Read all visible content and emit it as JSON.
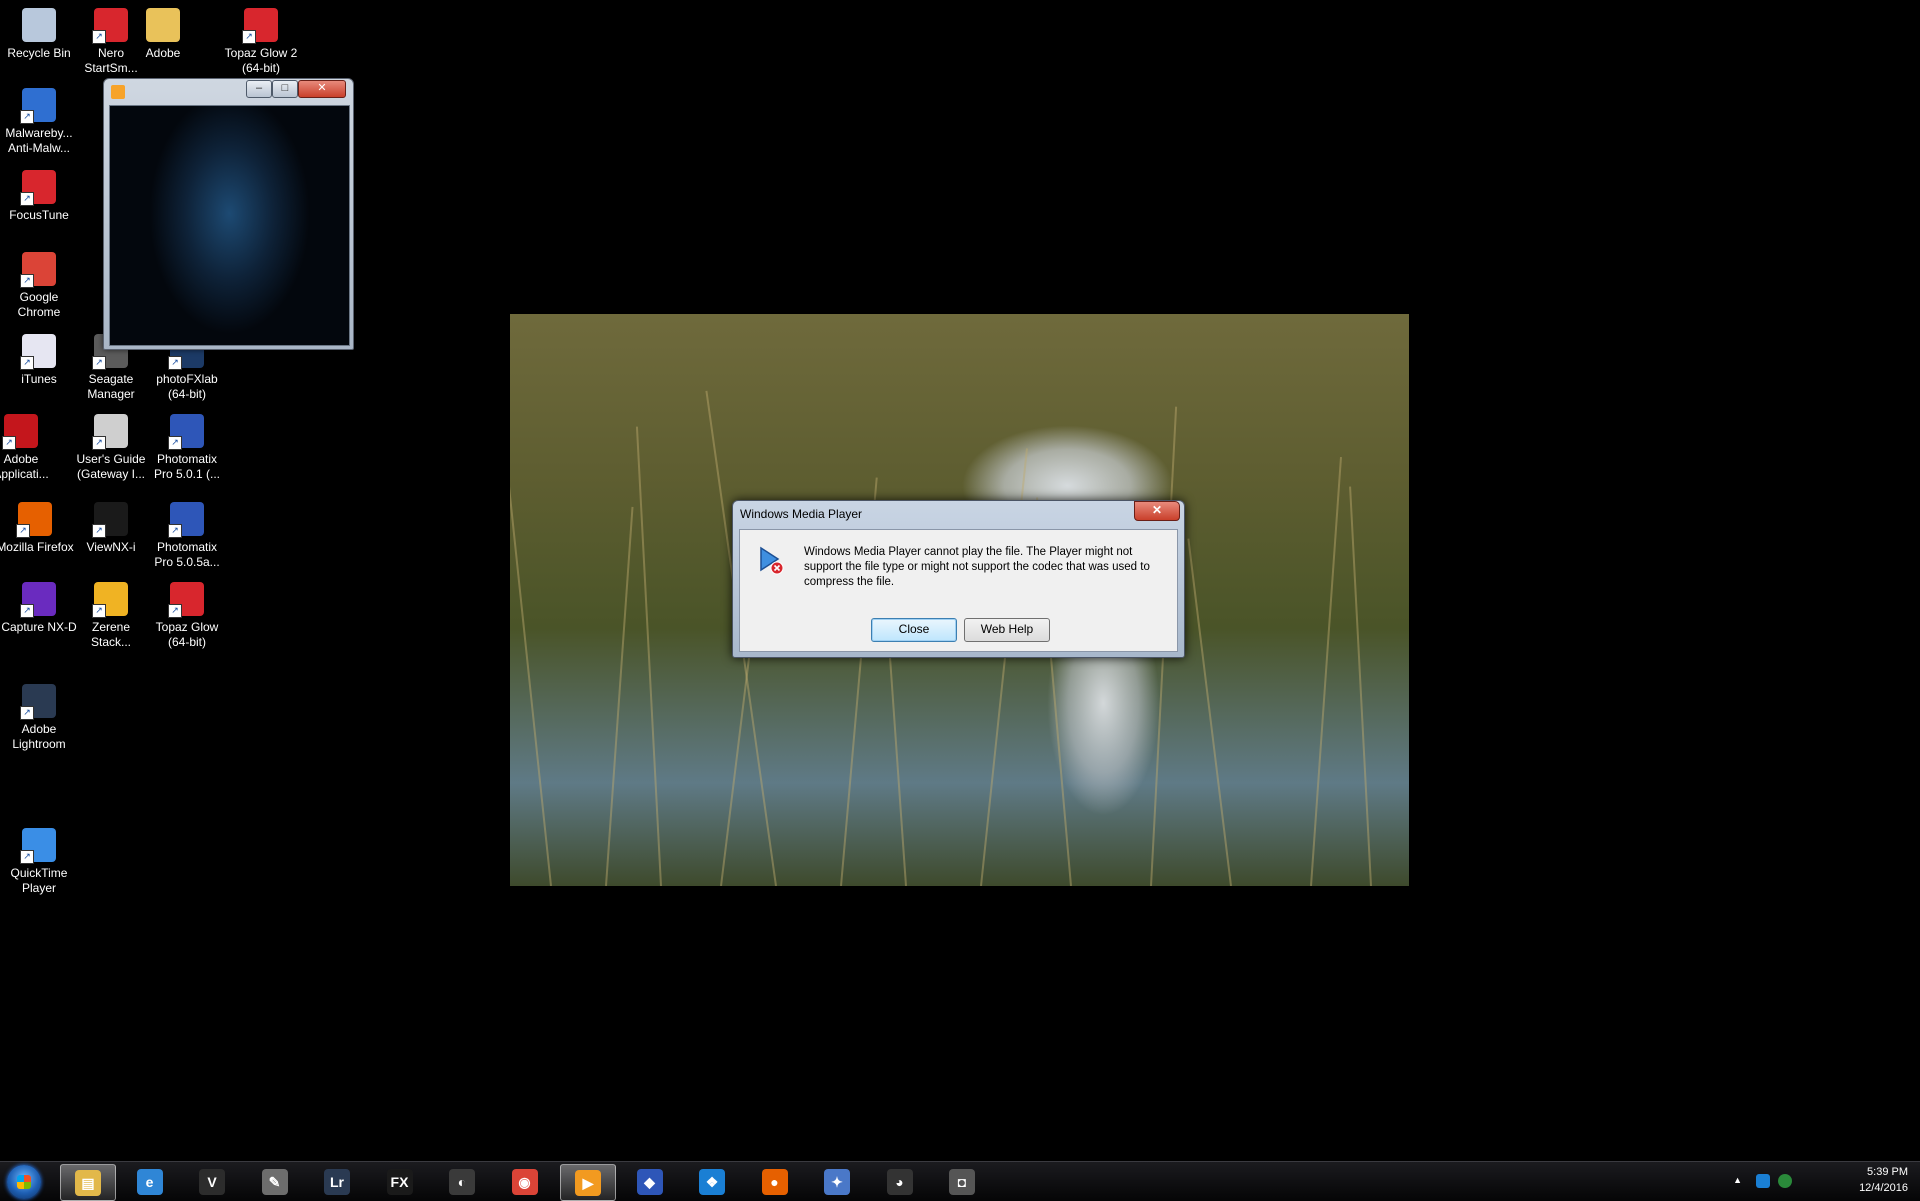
{
  "desktop": {
    "icons": [
      {
        "label": "Recycle Bin",
        "icon": "recycle-bin-icon",
        "color": "#b8c8dc"
      },
      {
        "label": "Nero StartSm...",
        "icon": "nero-icon",
        "color": "#d8262d"
      },
      {
        "label": "Adobe",
        "icon": "folder-icon",
        "color": "#e9c25a"
      },
      {
        "label": "Topaz Glow 2 (64-bit)",
        "icon": "topaz-glow-icon",
        "color": "#d8262d"
      },
      {
        "label": "Malwareby... Anti-Malw...",
        "icon": "malwarebytes-icon",
        "color": "#2f6fd1"
      },
      {
        "label": "FocusTune",
        "icon": "focustune-icon",
        "color": "#d8262d"
      },
      {
        "label": "Google Chrome",
        "icon": "chrome-icon",
        "color": "#db4437"
      },
      {
        "label": "iTunes",
        "icon": "itunes-icon",
        "color": "#e6e6f2"
      },
      {
        "label": "Seagate Manager",
        "icon": "seagate-icon",
        "color": "#5b5b5b"
      },
      {
        "label": "photoFXlab (64-bit)",
        "icon": "photofxlab-icon",
        "color": "#1c3a66"
      },
      {
        "label": "Adobe Applicati...",
        "icon": "adobe-icon",
        "color": "#c4161c"
      },
      {
        "label": "User's Guide (Gateway I...",
        "icon": "help-icon",
        "color": "#cfcfcf"
      },
      {
        "label": "Photomatix Pro 5.0.1 (...",
        "icon": "photomatix-icon",
        "color": "#2e56b8"
      },
      {
        "label": "Mozilla Firefox",
        "icon": "firefox-icon",
        "color": "#e66000"
      },
      {
        "label": "ViewNX-i",
        "icon": "viewnx-icon",
        "color": "#1a1a1a"
      },
      {
        "label": "Photomatix Pro 5.0.5a...",
        "icon": "photomatix-icon",
        "color": "#2e56b8"
      },
      {
        "label": "Capture NX-D",
        "icon": "capture-nx-icon",
        "color": "#6a2bbf"
      },
      {
        "label": "Zerene Stack...",
        "icon": "zerene-icon",
        "color": "#f0b323"
      },
      {
        "label": "Topaz Glow (64-bit)",
        "icon": "topaz-glow-icon",
        "color": "#d8262d"
      },
      {
        "label": "Adobe Lightroom",
        "icon": "lightroom-icon",
        "color": "#2a3a52"
      },
      {
        "label": "QuickTime Player",
        "icon": "quicktime-icon",
        "color": "#3a8ee6"
      }
    ]
  },
  "mini_window": {
    "app_icon": "windows-media-player-icon",
    "minimize": "–",
    "maximize": "□",
    "close": "✕"
  },
  "dialog": {
    "title": "Windows Media Player",
    "close_glyph": "✕",
    "message": "Windows Media Player cannot play the file. The Player might not support the file type or might not support the codec that was used to compress the file.",
    "icon": "media-error-icon",
    "buttons": {
      "close": "Close",
      "web_help": "Web Help"
    }
  },
  "taskbar": {
    "items": [
      {
        "name": "explorer",
        "icon": "folder-icon",
        "glyph": "▤",
        "color": "#e2b84a",
        "active": true
      },
      {
        "name": "internet-explorer",
        "icon": "ie-icon",
        "glyph": "e",
        "color": "#2f86d6",
        "active": false
      },
      {
        "name": "viewnx",
        "icon": "viewnx-icon",
        "glyph": "V",
        "color": "#2c2c2c",
        "active": false
      },
      {
        "name": "gimp",
        "icon": "gimp-icon",
        "glyph": "✎",
        "color": "#6d6d6d",
        "active": false
      },
      {
        "name": "lightroom",
        "icon": "lightroom-icon",
        "glyph": "Lr",
        "color": "#2a3a52",
        "active": false
      },
      {
        "name": "photofx",
        "icon": "fx-icon",
        "glyph": "FX",
        "color": "#1a1a1a",
        "active": false
      },
      {
        "name": "app",
        "icon": "app-icon",
        "glyph": "◐",
        "color": "#3a3a3a",
        "active": false
      },
      {
        "name": "chrome",
        "icon": "chrome-icon",
        "glyph": "◉",
        "color": "#db4437",
        "active": false
      },
      {
        "name": "media-player",
        "icon": "windows-media-player-icon",
        "glyph": "▶",
        "color": "#f29a20",
        "active": true
      },
      {
        "name": "photomatix",
        "icon": "photomatix-icon",
        "glyph": "◆",
        "color": "#2e56b8",
        "active": false
      },
      {
        "name": "dropbox",
        "icon": "dropbox-icon",
        "glyph": "❖",
        "color": "#1a7fd4",
        "active": false
      },
      {
        "name": "firefox",
        "icon": "firefox-icon",
        "glyph": "●",
        "color": "#e66000",
        "active": false
      },
      {
        "name": "app2",
        "icon": "paint-icon",
        "glyph": "✦",
        "color": "#4a78c8",
        "active": false
      },
      {
        "name": "app3",
        "icon": "panda-icon",
        "glyph": "◕",
        "color": "#333333",
        "active": false
      },
      {
        "name": "app4",
        "icon": "camera-icon",
        "glyph": "◘",
        "color": "#555555",
        "active": false
      }
    ],
    "tray": {
      "time": "5:39 PM",
      "date": "12/4/2016",
      "show_hidden": "▲"
    }
  }
}
